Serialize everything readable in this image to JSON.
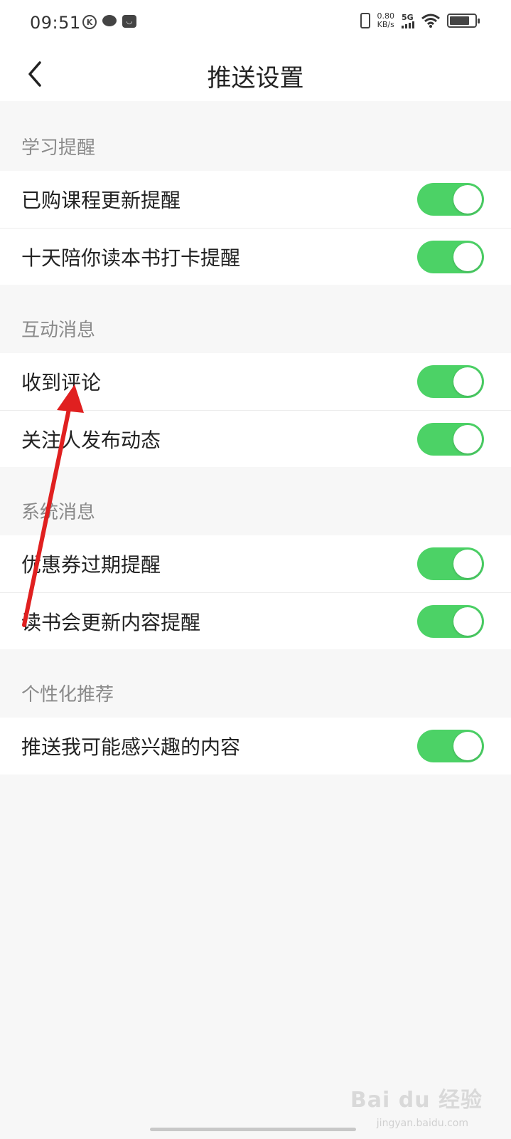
{
  "status_bar": {
    "time": "09:51",
    "left_icons": [
      "k-app-icon",
      "chat-bubble-icon",
      "shopping-bag-icon"
    ],
    "net_speed_value": "0.80",
    "net_speed_unit": "KB/s",
    "network_type": "5G",
    "right_icons": [
      "vibrate-icon",
      "signal-icon",
      "wifi-icon",
      "battery-icon"
    ]
  },
  "header": {
    "title": "推送设置",
    "back_icon": "chevron-left-icon"
  },
  "sections": [
    {
      "title": "学习提醒",
      "items": [
        {
          "label": "已购课程更新提醒",
          "enabled": true
        },
        {
          "label": "十天陪你读本书打卡提醒",
          "enabled": true
        }
      ]
    },
    {
      "title": "互动消息",
      "items": [
        {
          "label": "收到评论",
          "enabled": true
        },
        {
          "label": "关注人发布动态",
          "enabled": true
        }
      ]
    },
    {
      "title": "系统消息",
      "items": [
        {
          "label": "优惠券过期提醒",
          "enabled": true
        },
        {
          "label": "读书会更新内容提醒",
          "enabled": true
        }
      ]
    },
    {
      "title": "个性化推荐",
      "items": [
        {
          "label": "推送我可能感兴趣的内容",
          "enabled": true
        }
      ]
    }
  ],
  "annotation": {
    "type": "arrow",
    "color": "#e02020",
    "points_to": "收到评论"
  },
  "watermark": {
    "text": "Bai du 经验",
    "sub": "jingyan.baidu.com"
  },
  "colors": {
    "toggle_on": "#4cd266",
    "background": "#f7f7f7",
    "section_text": "#8a8a8a"
  }
}
